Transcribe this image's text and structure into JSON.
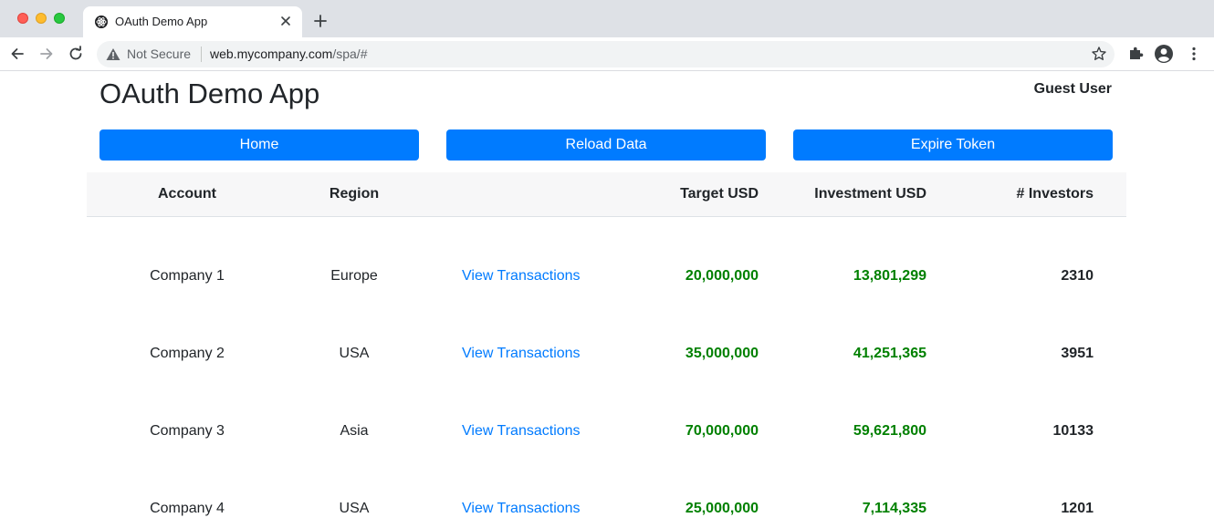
{
  "browser": {
    "tab_title": "OAuth Demo App",
    "security_label": "Not Secure",
    "url_host": "web.mycompany.com",
    "url_path": "/spa/#"
  },
  "app": {
    "title": "OAuth Demo App",
    "user": "Guest User",
    "buttons": {
      "home": "Home",
      "reload": "Reload Data",
      "expire": "Expire Token"
    },
    "accent_color": "#007bff",
    "money_color": "#008000"
  },
  "table": {
    "headers": {
      "account": "Account",
      "region": "Region",
      "target": "Target USD",
      "investment": "Investment USD",
      "investors": "# Investors"
    },
    "rows": [
      {
        "account": "Company 1",
        "region": "Europe",
        "link": "View Transactions",
        "target": "20,000,000",
        "investment": "13,801,299",
        "investors": "2310"
      },
      {
        "account": "Company 2",
        "region": "USA",
        "link": "View Transactions",
        "target": "35,000,000",
        "investment": "41,251,365",
        "investors": "3951"
      },
      {
        "account": "Company 3",
        "region": "Asia",
        "link": "View Transactions",
        "target": "70,000,000",
        "investment": "59,621,800",
        "investors": "10133"
      },
      {
        "account": "Company 4",
        "region": "USA",
        "link": "View Transactions",
        "target": "25,000,000",
        "investment": "7,114,335",
        "investors": "1201"
      }
    ]
  }
}
